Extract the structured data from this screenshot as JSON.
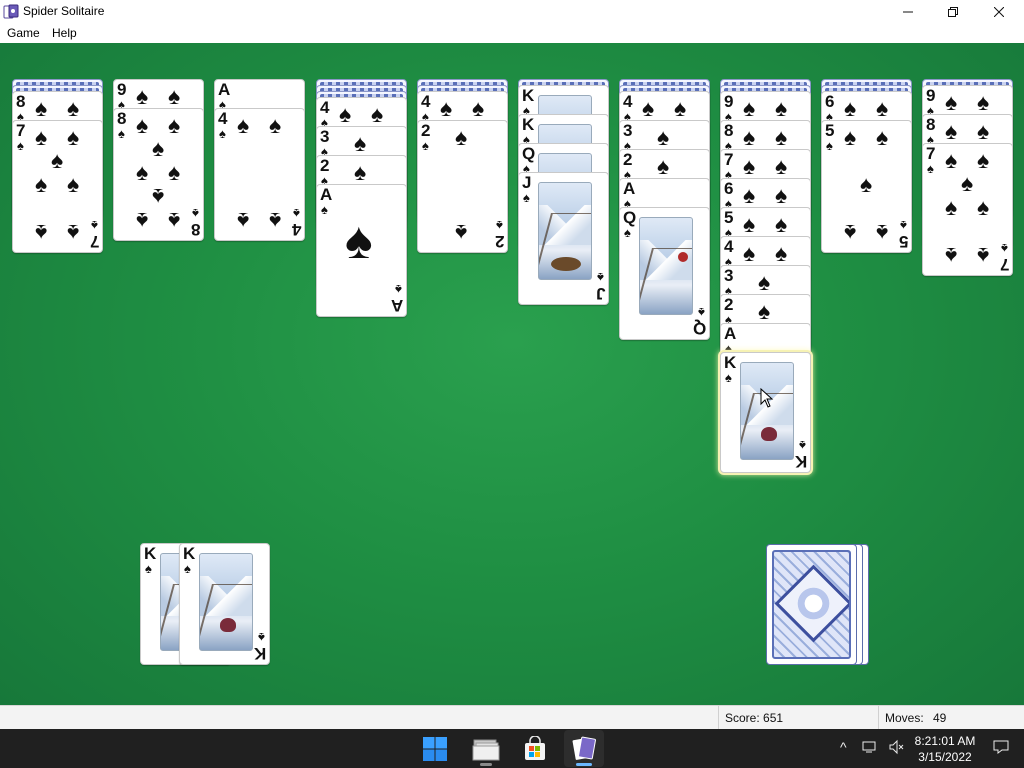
{
  "window": {
    "title": "Spider Solitaire"
  },
  "menu": {
    "game": "Game",
    "help": "Help"
  },
  "tableau": [
    {
      "down": 2,
      "cards": [
        {
          "rank": "8",
          "suit": "♠"
        },
        {
          "rank": "7",
          "suit": "♠"
        }
      ]
    },
    {
      "down": 0,
      "cards": [
        {
          "rank": "9",
          "suit": "♠"
        },
        {
          "rank": "8",
          "suit": "♠"
        }
      ]
    },
    {
      "down": 0,
      "cards": [
        {
          "rank": "A",
          "suit": "♠"
        },
        {
          "rank": "4",
          "suit": "♠"
        }
      ]
    },
    {
      "down": 3,
      "cards": [
        {
          "rank": "4",
          "suit": "♠"
        },
        {
          "rank": "3",
          "suit": "♠"
        },
        {
          "rank": "2",
          "suit": "♠"
        },
        {
          "rank": "A",
          "suit": "♠"
        }
      ]
    },
    {
      "down": 2,
      "cards": [
        {
          "rank": "4",
          "suit": "♠"
        },
        {
          "rank": "2",
          "suit": "♠"
        }
      ]
    },
    {
      "down": 1,
      "cards": [
        {
          "rank": "K",
          "suit": "♠"
        },
        {
          "rank": "K",
          "suit": "♠"
        },
        {
          "rank": "Q",
          "suit": "♠"
        },
        {
          "rank": "J",
          "suit": "♠"
        }
      ]
    },
    {
      "down": 2,
      "cards": [
        {
          "rank": "4",
          "suit": "♠"
        },
        {
          "rank": "3",
          "suit": "♠"
        },
        {
          "rank": "2",
          "suit": "♠"
        },
        {
          "rank": "A",
          "suit": "♠"
        },
        {
          "rank": "Q",
          "suit": "♠"
        }
      ]
    },
    {
      "down": 2,
      "cards": [
        {
          "rank": "9",
          "suit": "♠"
        },
        {
          "rank": "8",
          "suit": "♠"
        },
        {
          "rank": "7",
          "suit": "♠"
        },
        {
          "rank": "6",
          "suit": "♠"
        },
        {
          "rank": "5",
          "suit": "♠"
        },
        {
          "rank": "4",
          "suit": "♠"
        },
        {
          "rank": "3",
          "suit": "♠"
        },
        {
          "rank": "2",
          "suit": "♠"
        },
        {
          "rank": "A",
          "suit": "♠"
        },
        {
          "rank": "K",
          "suit": "♠",
          "selected": true
        }
      ]
    },
    {
      "down": 2,
      "cards": [
        {
          "rank": "6",
          "suit": "♠"
        },
        {
          "rank": "5",
          "suit": "♠"
        }
      ]
    },
    {
      "down": 1,
      "cards": [
        {
          "rank": "9",
          "suit": "♠"
        },
        {
          "rank": "8",
          "suit": "♠"
        },
        {
          "rank": "7",
          "suit": "♠"
        }
      ]
    }
  ],
  "foundations": [
    {
      "rank": "K",
      "suit": "♠"
    },
    {
      "rank": "K",
      "suit": "♠"
    }
  ],
  "stock": {
    "piles": 3
  },
  "status": {
    "score_text": "Score: 651",
    "moves_label": "Moves:",
    "moves_value": "49"
  },
  "taskbar": {
    "apps": [
      "start-icon",
      "file-explorer-icon",
      "store-icon",
      "spider-solitaire-icon"
    ],
    "time": "8:21:01 AM",
    "date": "3/15/2022"
  },
  "colors": {
    "felt": "#1f8f43",
    "taskbar": "#202020",
    "accent": "#6cb8ff"
  }
}
